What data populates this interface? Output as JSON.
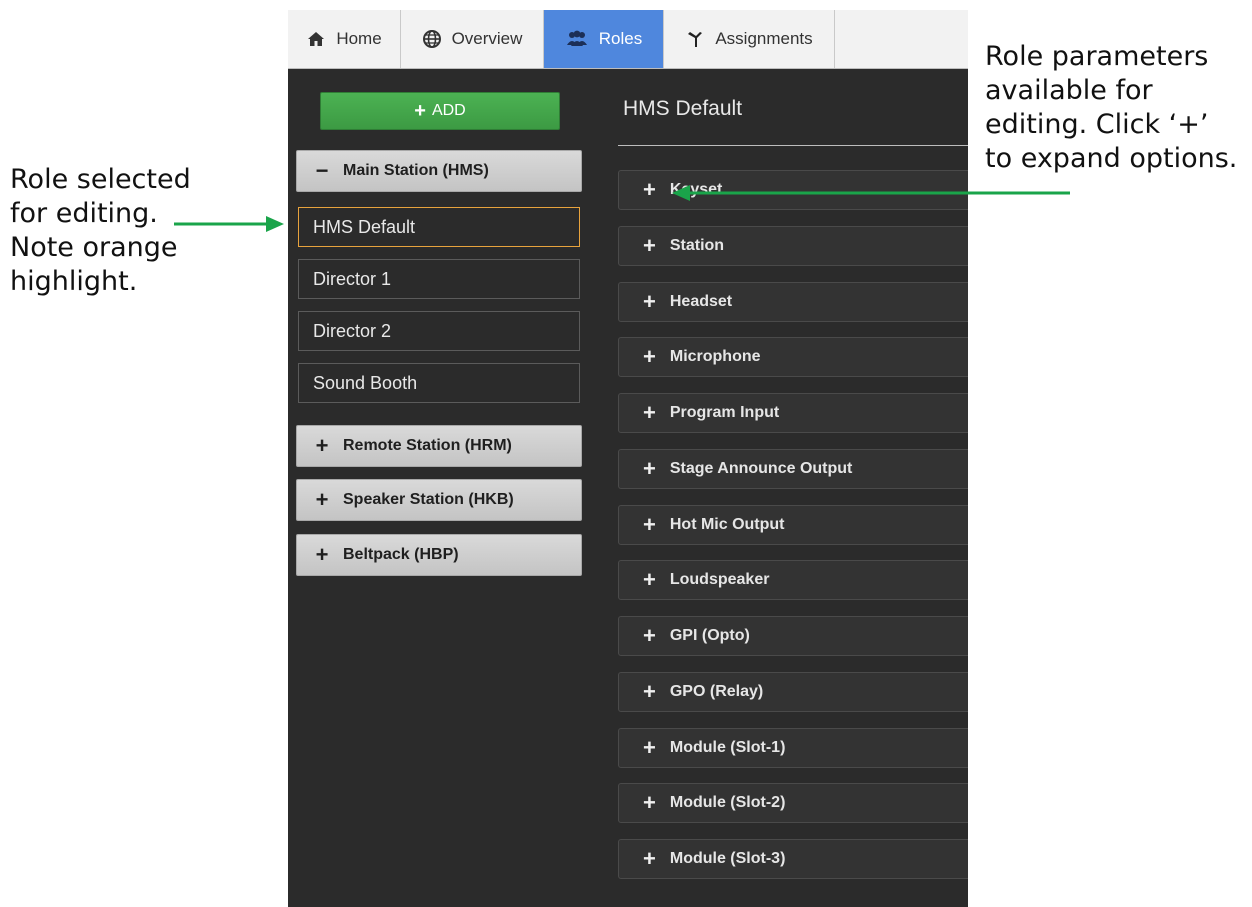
{
  "annotations": {
    "left": "Role selected\nfor editing.\nNote orange\nhighlight.",
    "right": "Role parameters\navailable for\nediting. Click ‘+’\nto expand options.",
    "arrow_color": "#1aa44a"
  },
  "tabs": [
    {
      "label": "Home",
      "icon": "home-icon"
    },
    {
      "label": "Overview",
      "icon": "globe-icon"
    },
    {
      "label": "Roles",
      "icon": "users-icon",
      "active": true
    },
    {
      "label": "Assignments",
      "icon": "assignments-icon"
    }
  ],
  "sidebar": {
    "add_label": "ADD",
    "groups": [
      {
        "label": "Main Station (HMS)",
        "expanded": true,
        "roles": [
          "HMS Default",
          "Director 1",
          "Director 2",
          "Sound Booth"
        ]
      },
      {
        "label": "Remote Station (HRM)",
        "expanded": false
      },
      {
        "label": "Speaker Station (HKB)",
        "expanded": false
      },
      {
        "label": "Beltpack (HBP)",
        "expanded": false
      }
    ],
    "selected_role": "HMS Default"
  },
  "main": {
    "title": "HMS Default",
    "params": [
      "Keyset",
      "Station",
      "Headset",
      "Microphone",
      "Program Input",
      "Stage Announce Output",
      "Hot Mic Output",
      "Loudspeaker",
      "GPI (Opto)",
      "GPO (Relay)",
      "Module (Slot-1)",
      "Module (Slot-2)",
      "Module (Slot-3)"
    ]
  },
  "colors": {
    "accent_tab": "#4f87dd",
    "add_button": "#45a84c",
    "selected_border": "#e8a33d",
    "panel_bg": "#2b2b2b"
  }
}
